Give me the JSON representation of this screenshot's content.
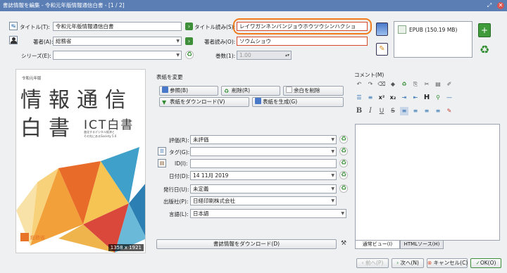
{
  "window": {
    "title": "書誌情報を編集 - 令和元年版情報通信白書 - [1 / 2]"
  },
  "colors": {
    "titlebar": "#5b7fb5",
    "highlight": "#f07c1e",
    "accent_red": "#d64a2a",
    "ok_border": "#3f8f3a"
  },
  "icons": [
    "title-copy-icon",
    "author-person-icon",
    "cover-image-icon",
    "edit-metadata-icon",
    "add-format-icon",
    "remove-format-icon",
    "recycle-icon",
    "arrow-right-icon"
  ],
  "fields": {
    "title": {
      "label": "タイトル(T):",
      "value": "令和元年版情報通信白書"
    },
    "title_sort": {
      "label": "タイトル読み(S):",
      "value": "レイワガンネンバンジョウホウツウシンハクショ"
    },
    "authors": {
      "label": "著者(A):",
      "value": "総務省"
    },
    "author_sort": {
      "label": "著者読み(O):",
      "value": "ソウムショウ"
    },
    "series": {
      "label": "シリーズ(E):",
      "value": ""
    },
    "series_index": {
      "label": "巻数(1):",
      "value": "1.00"
    }
  },
  "formats": {
    "items": [
      {
        "label": "EPUB (150.19 MB)"
      }
    ]
  },
  "cover": {
    "size_label": "1358 x 1921",
    "small_title": "令和元年版",
    "line1": "情報通信",
    "line2": "白書",
    "subtitle": "ICT白書",
    "caption1": "進化するデジタル経済と",
    "caption2": "その先にあるSociety 5.0",
    "publisher_logo": "総務省"
  },
  "cover_actions": {
    "header": "表紙を変更",
    "browse": "参照(B)",
    "remove": "削除(R)",
    "trim": "余白を削除",
    "download": "表紙をダウンロード(V)",
    "generate": "表紙を生成(G)"
  },
  "meta": {
    "rating": {
      "label": "評価(R):",
      "value": "未評価"
    },
    "tags": {
      "label": "タグ(G):",
      "value": ""
    },
    "ids": {
      "label": "ID(I):",
      "value": ""
    },
    "date": {
      "label": "日付(D):",
      "value": "14 11月 2019"
    },
    "published": {
      "label": "発行日(U):",
      "value": "未定義"
    },
    "publisher": {
      "label": "出版社(P):",
      "value": "日経印刷株式会社"
    },
    "languages": {
      "label": "言語(L):",
      "value": "日本語"
    }
  },
  "download_metadata": "書誌情報をダウンロード(D)",
  "comments": {
    "header": "コメント(M)",
    "tabs": [
      {
        "label": "通常ビュー(I)"
      },
      {
        "label": "HTMLソース(H)"
      }
    ],
    "content": ""
  },
  "footer": {
    "prev": "前へ(P)",
    "next": "次へ(N)",
    "cancel": "キャンセル(C)",
    "ok": "OK(O)"
  }
}
